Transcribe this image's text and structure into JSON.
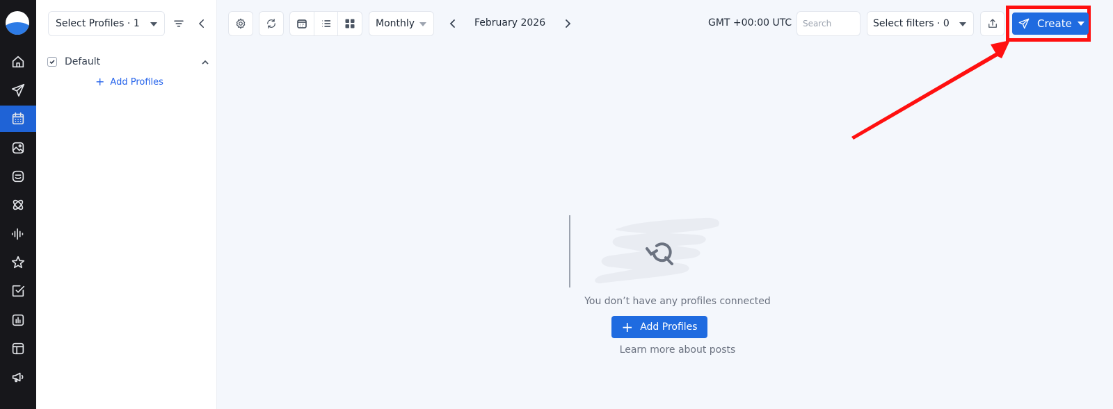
{
  "nav_rail": {
    "items": [
      {
        "icon": "home-icon"
      },
      {
        "icon": "send-icon"
      },
      {
        "icon": "calendar-icon",
        "active": true
      },
      {
        "icon": "media-library-icon"
      },
      {
        "icon": "inbox-icon"
      },
      {
        "icon": "atom-icon"
      },
      {
        "icon": "audio-waves-icon"
      },
      {
        "icon": "star-icon"
      },
      {
        "icon": "checkbox-icon"
      },
      {
        "icon": "analytics-icon"
      },
      {
        "icon": "layout-icon"
      },
      {
        "icon": "megaphone-icon"
      }
    ]
  },
  "sidebar": {
    "profile_select_label": "Select Profiles · 1",
    "group": {
      "label": "Default",
      "checked": true
    },
    "add_profiles_label": "Add Profiles"
  },
  "toolbar": {
    "period": "Monthly",
    "month": "February 2026",
    "timezone": "GMT +00:00 UTC",
    "search_placeholder": "Search",
    "filters_label": "Select filters · 0",
    "create_label": "Create"
  },
  "empty_state": {
    "message": "You don’t have any profiles connected",
    "button_label": "Add Profiles",
    "learn_more": "Learn more about posts"
  },
  "colors": {
    "rail": "#17171b",
    "accent": "#1f6be0",
    "annotation": "#ff1010",
    "canvas": "#f4f7fc"
  }
}
